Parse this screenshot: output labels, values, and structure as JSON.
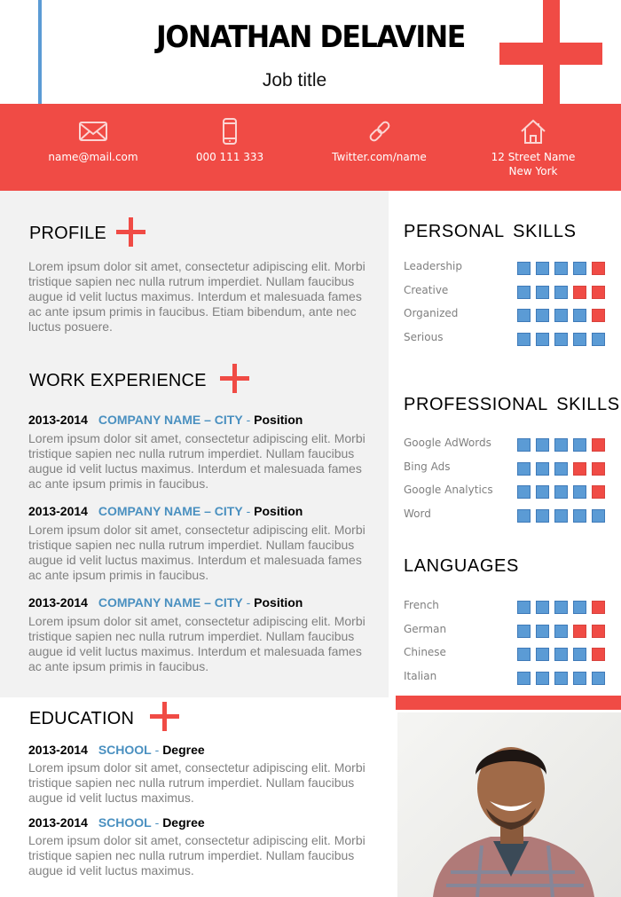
{
  "header": {
    "name": "JONATHAN DELAVINE",
    "job_title": "Job title"
  },
  "contact": {
    "email": {
      "icon": "envelope-icon",
      "text": "name@mail.com"
    },
    "phone": {
      "icon": "phone-icon",
      "text": "000 111 333"
    },
    "social": {
      "icon": "link-icon",
      "text": "Twitter.com/name"
    },
    "address": {
      "icon": "house-icon",
      "line1": "12 Street Name",
      "line2": "New York"
    }
  },
  "profile": {
    "title": "PROFILE",
    "text": "Lorem ipsum dolor sit amet, consectetur adipiscing elit. Morbi tristique sapien nec nulla rutrum imperdiet. Nullam faucibus augue id velit luctus maximus. Interdum et malesuada fames ac ante ipsum primis in faucibus. Etiam bibendum, ante nec luctus posuere."
  },
  "work": {
    "title": "WORK EXPERIENCE",
    "entries": [
      {
        "years": "2013-2014",
        "org": "COMPANY NAME – CITY",
        "sep": " - ",
        "role": "Position",
        "text": "Lorem ipsum dolor sit amet, consectetur adipiscing elit. Morbi tristique sapien nec nulla rutrum imperdiet. Nullam faucibus augue id velit luctus maximus. Interdum et malesuada fames ac ante ipsum primis in faucibus."
      },
      {
        "years": "2013-2014",
        "org": "COMPANY NAME – CITY",
        "sep": " - ",
        "role": "Position",
        "text": "Lorem ipsum dolor sit amet, consectetur adipiscing elit. Morbi tristique sapien nec nulla rutrum imperdiet. Nullam faucibus augue id velit luctus maximus. Interdum et malesuada fames ac ante ipsum primis in faucibus."
      },
      {
        "years": "2013-2014",
        "org": "COMPANY NAME – CITY",
        "sep": " - ",
        "role": "Position",
        "text": "Lorem ipsum dolor sit amet, consectetur adipiscing elit. Morbi tristique sapien nec nulla rutrum imperdiet. Nullam faucibus augue id velit luctus maximus. Interdum et malesuada fames ac ante ipsum primis in faucibus."
      }
    ]
  },
  "education": {
    "title": "EDUCATION",
    "entries": [
      {
        "years": "2013-2014",
        "org": "SCHOOL",
        "sep": " - ",
        "role": "Degree",
        "text": "Lorem ipsum dolor sit amet, consectetur adipiscing elit. Morbi tristique sapien nec nulla rutrum imperdiet. Nullam faucibus augue id velit luctus maximus."
      },
      {
        "years": "2013-2014",
        "org": "SCHOOL",
        "sep": " - ",
        "role": "Degree",
        "text": "Lorem ipsum dolor sit amet, consectetur adipiscing elit. Morbi tristique sapien nec nulla rutrum imperdiet. Nullam faucibus augue id velit luctus maximus."
      }
    ]
  },
  "personal_skills": {
    "title": "PERSONAL SKILLS",
    "max": 5,
    "items": [
      {
        "label": "Leadership",
        "level": 4
      },
      {
        "label": "Creative",
        "level": 3
      },
      {
        "label": "Organized",
        "level": 4
      },
      {
        "label": "Serious",
        "level": 5
      }
    ]
  },
  "professional_skills": {
    "title": "PROFESSIONAL SKILLS",
    "max": 5,
    "items": [
      {
        "label": "Google AdWords",
        "level": 4
      },
      {
        "label": "Bing Ads",
        "level": 3
      },
      {
        "label": "Google Analytics",
        "level": 4
      },
      {
        "label": "Word",
        "level": 5
      }
    ]
  },
  "languages": {
    "title": "LANGUAGES",
    "max": 5,
    "items": [
      {
        "label": "French",
        "level": 4
      },
      {
        "label": "German",
        "level": 3
      },
      {
        "label": "Chinese",
        "level": 4
      },
      {
        "label": "Italian",
        "level": 5
      }
    ]
  },
  "photo": {
    "alt": "Smiling man in plaid shirt"
  },
  "colors": {
    "accent_red": "#f04b45",
    "accent_blue": "#5b9bd5",
    "company_blue": "#4a90c0",
    "body_grey": "#808080",
    "panel_grey": "#f2f2f2"
  }
}
